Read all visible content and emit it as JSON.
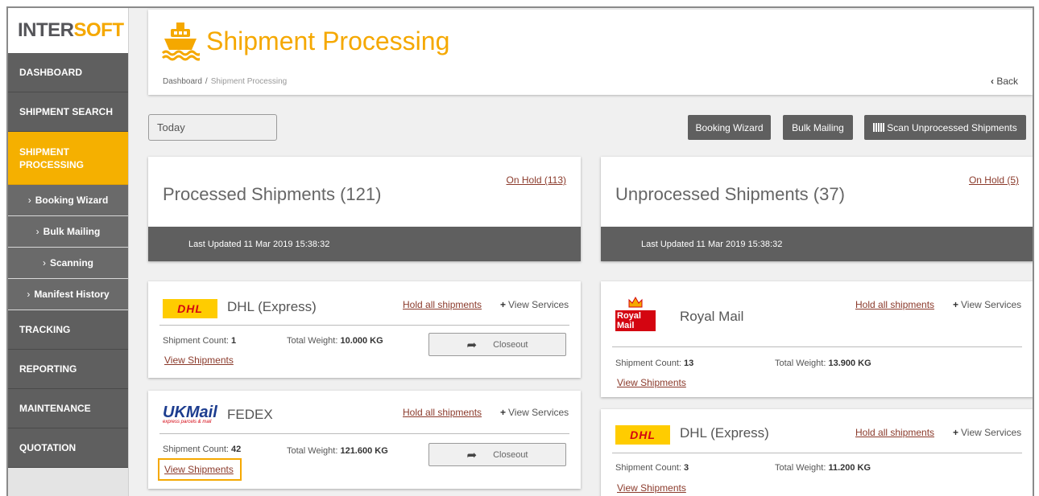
{
  "sidebar": {
    "logo": {
      "dark": "INTER",
      "accent": "SOFT"
    },
    "items": [
      {
        "label": "DASHBOARD"
      },
      {
        "label": "SHIPMENT SEARCH"
      },
      {
        "label": "SHIPMENT PROCESSING"
      },
      {
        "label": "TRACKING"
      },
      {
        "label": "REPORTING"
      },
      {
        "label": "MAINTENANCE"
      },
      {
        "label": "QUOTATION"
      }
    ],
    "sub_items": [
      {
        "label": "Booking Wizard"
      },
      {
        "label": "Bulk Mailing"
      },
      {
        "label": "Scanning"
      },
      {
        "label": "Manifest History"
      }
    ],
    "active_color": "#f5b000"
  },
  "header": {
    "title": "Shipment Processing",
    "breadcrumb": {
      "root": "Dashboard",
      "separator": "/",
      "current": "Shipment Processing"
    },
    "back_label": "Back",
    "icon": "ship-icon"
  },
  "toolbar": {
    "date_filter_value": "Today",
    "booking_wizard_label": "Booking Wizard",
    "bulk_mailing_label": "Bulk Mailing",
    "scan_label": "Scan Unprocessed Shipments"
  },
  "processed": {
    "title": "Processed Shipments (121)",
    "on_hold": "On Hold (113)",
    "last_updated": "Last Updated 11 Mar 2019 15:38:32"
  },
  "unprocessed": {
    "title": "Unprocessed Shipments (37)",
    "on_hold": "On Hold (5)",
    "last_updated": "Last Updated 11 Mar 2019 15:38:32"
  },
  "labels": {
    "hold_all": "Hold all shipments",
    "view_services": "View Services",
    "shipment_count": "Shipment Count:",
    "total_weight": "Total Weight:",
    "view_shipments": "View Shipments",
    "closeout": "Closeout"
  },
  "carriers": {
    "processed": [
      {
        "name": "DHL (Express)",
        "logo_text": "DHL",
        "count": "1",
        "weight": "10.000 KG"
      },
      {
        "name": "FEDEX",
        "logo_text": "UKMail",
        "logo_sub": "express parcels & mail",
        "count": "42",
        "weight": "121.600 KG"
      }
    ],
    "unprocessed": [
      {
        "name": "Royal Mail",
        "logo_text": "Royal Mail",
        "count": "13",
        "weight": "13.900 KG"
      },
      {
        "name": "DHL (Express)",
        "logo_text": "DHL",
        "count": "3",
        "weight": "11.200 KG"
      }
    ]
  }
}
